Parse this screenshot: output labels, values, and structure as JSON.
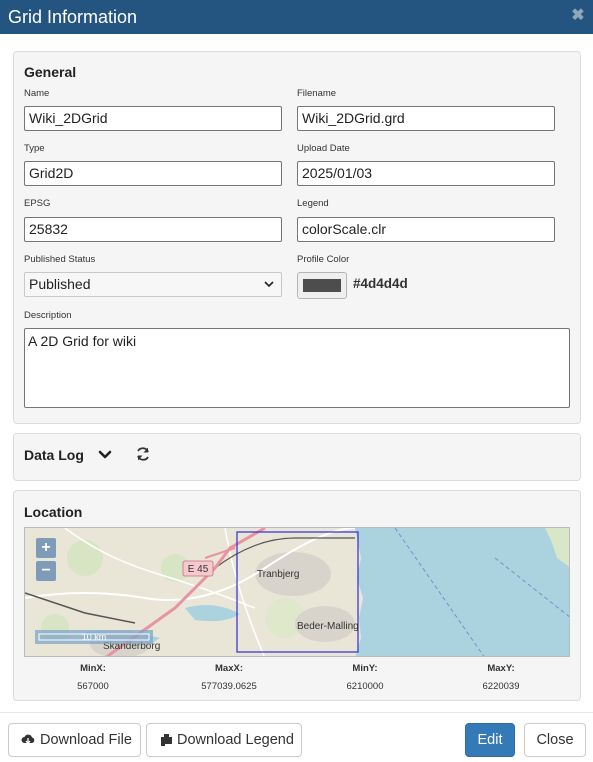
{
  "header": {
    "title": "Grid Information",
    "close_icon": "close-icon"
  },
  "general": {
    "heading": "General",
    "name": {
      "label": "Name",
      "value": "Wiki_2DGrid"
    },
    "filename": {
      "label": "Filename",
      "value": "Wiki_2DGrid.grd"
    },
    "type": {
      "label": "Type",
      "value": "Grid2D"
    },
    "upload_date": {
      "label": "Upload Date",
      "value": "2025/01/03"
    },
    "epsg": {
      "label": "EPSG",
      "value": "25832"
    },
    "legend": {
      "label": "Legend",
      "value": "colorScale.clr"
    },
    "published_status": {
      "label": "Published Status",
      "value": "Published"
    },
    "profile_color": {
      "label": "Profile Color",
      "value": "#4d4d4d"
    },
    "description": {
      "label": "Description",
      "value": "A 2D Grid for wiki"
    }
  },
  "data_log": {
    "heading": "Data Log",
    "toggle_icon": "chevron-down-icon",
    "refresh_icon": "refresh-icon"
  },
  "location": {
    "heading": "Location",
    "map": {
      "road_label": "E 45",
      "places": [
        "Tranbjerg",
        "Beder-Malling",
        "Skanderborg"
      ],
      "scale": "10 km",
      "zoom_in": "+",
      "zoom_out": "−",
      "colors": {
        "water": "#aad3df",
        "land": "#e9e5d7",
        "bbox": "#3b3bd6",
        "motorway": "#e892a2"
      }
    },
    "bounds": {
      "minx": {
        "label": "MinX:",
        "value": "567000"
      },
      "maxx": {
        "label": "MaxX:",
        "value": "577039.0625"
      },
      "miny": {
        "label": "MinY:",
        "value": "6210000"
      },
      "maxy": {
        "label": "MaxY:",
        "value": "6220039"
      }
    }
  },
  "footer": {
    "download_file": "Download File",
    "download_legend": "Download Legend",
    "edit": "Edit",
    "close": "Close"
  }
}
